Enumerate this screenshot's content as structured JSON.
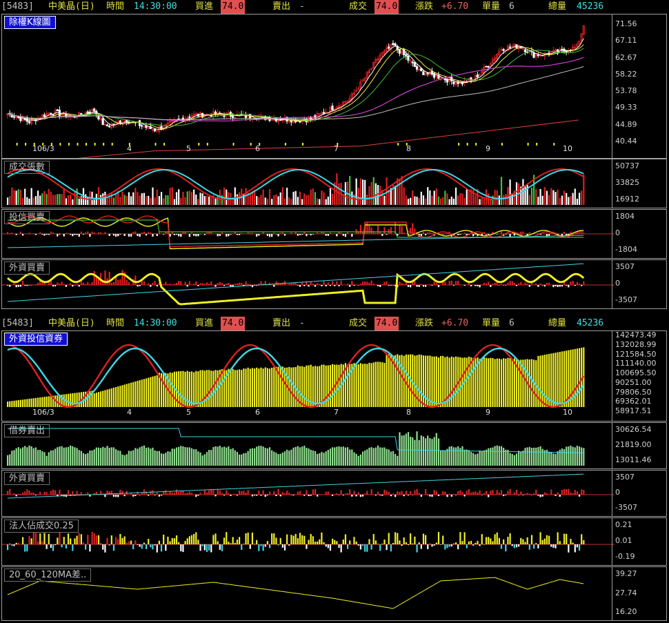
{
  "header": {
    "code": "[5483]",
    "name": "中美晶(日)",
    "time_label": "時間",
    "time": "14:30:00",
    "bid_label": "買進",
    "bid": "74.0",
    "ask_label": "賣出",
    "ask": "-",
    "trade_label": "成交",
    "trade": "74.0",
    "change_label": "漲跌",
    "change": "+6.70",
    "qty_label": "單量",
    "qty": "6",
    "vol_label": "總量",
    "vol": "45236"
  },
  "colors": {
    "up": "#e02020",
    "down": "#ffffff",
    "yellow": "#f0f020",
    "cyan": "#40d8e8",
    "green": "#40c040",
    "magenta": "#d040d0",
    "salmon": "#f06060"
  },
  "x_axis": {
    "labels": [
      "106/3",
      "4",
      "5",
      "6",
      "7",
      "8",
      "9",
      "10"
    ]
  },
  "panels": [
    {
      "id": "kline",
      "label": "除權K線圖",
      "ticks": [
        "71.56",
        "67.11",
        "62.67",
        "58.22",
        "53.78",
        "49.33",
        "44.89",
        "40.44"
      ]
    },
    {
      "id": "volume",
      "label": "成交張數",
      "ticks": [
        "50737",
        "33825",
        "16912"
      ]
    },
    {
      "id": "trust",
      "label": "投信買賣",
      "ticks": [
        "1804",
        "0",
        "-1804"
      ]
    },
    {
      "id": "foreign",
      "label": "外資買賣",
      "ticks": [
        "3507",
        "0",
        "-3507"
      ]
    },
    {
      "id": "combo",
      "label": "外資投信資券",
      "ticks": [
        "142473.49",
        "132028.99",
        "121584.50",
        "111140.00",
        "100695.50",
        "90251.00",
        "79806.50",
        "69362.01",
        "58917.51"
      ]
    },
    {
      "id": "short",
      "label": "借券賣出",
      "ticks": [
        "30626.54",
        "21819.00",
        "13011.46"
      ]
    },
    {
      "id": "foreign2",
      "label": "外資買賣",
      "ticks": [
        "3507",
        "0",
        "-3507"
      ]
    },
    {
      "id": "inst",
      "label": "法人佔成交0.25",
      "ticks": [
        "0.21",
        "0.01",
        "-0.19"
      ]
    },
    {
      "id": "madiff",
      "label": "20_60_120MA差..",
      "ticks": [
        "39.27",
        "27.74",
        "16.20"
      ]
    }
  ],
  "chart_data": [
    {
      "type": "candlestick",
      "title": "除權K線圖",
      "ylim": [
        38,
        74.5
      ],
      "x_labels": [
        "106/3",
        "4",
        "5",
        "6",
        "7",
        "8",
        "9",
        "10"
      ],
      "last_close": 74.0,
      "close_keypoints": [
        [
          0,
          47
        ],
        [
          10,
          44.5
        ],
        [
          20,
          47.5
        ],
        [
          30,
          46
        ],
        [
          40,
          48
        ],
        [
          45,
          43
        ],
        [
          55,
          45
        ],
        [
          63,
          43
        ],
        [
          68,
          42
        ],
        [
          72,
          43
        ],
        [
          85,
          46.5
        ],
        [
          95,
          46.8
        ],
        [
          105,
          46.5
        ],
        [
          120,
          45.6
        ],
        [
          135,
          45
        ],
        [
          140,
          45.3
        ],
        [
          148,
          48
        ],
        [
          158,
          51.5
        ],
        [
          165,
          58
        ],
        [
          172,
          65
        ],
        [
          178,
          68
        ],
        [
          183,
          65
        ],
        [
          190,
          60
        ],
        [
          198,
          58.5
        ],
        [
          205,
          57
        ],
        [
          210,
          56.5
        ],
        [
          215,
          57.5
        ],
        [
          222,
          62
        ],
        [
          228,
          67
        ],
        [
          236,
          68
        ],
        [
          243,
          65
        ],
        [
          250,
          65.5
        ],
        [
          258,
          66.5
        ],
        [
          263,
          67.5
        ],
        [
          266,
          74
        ]
      ]
    }
  ]
}
